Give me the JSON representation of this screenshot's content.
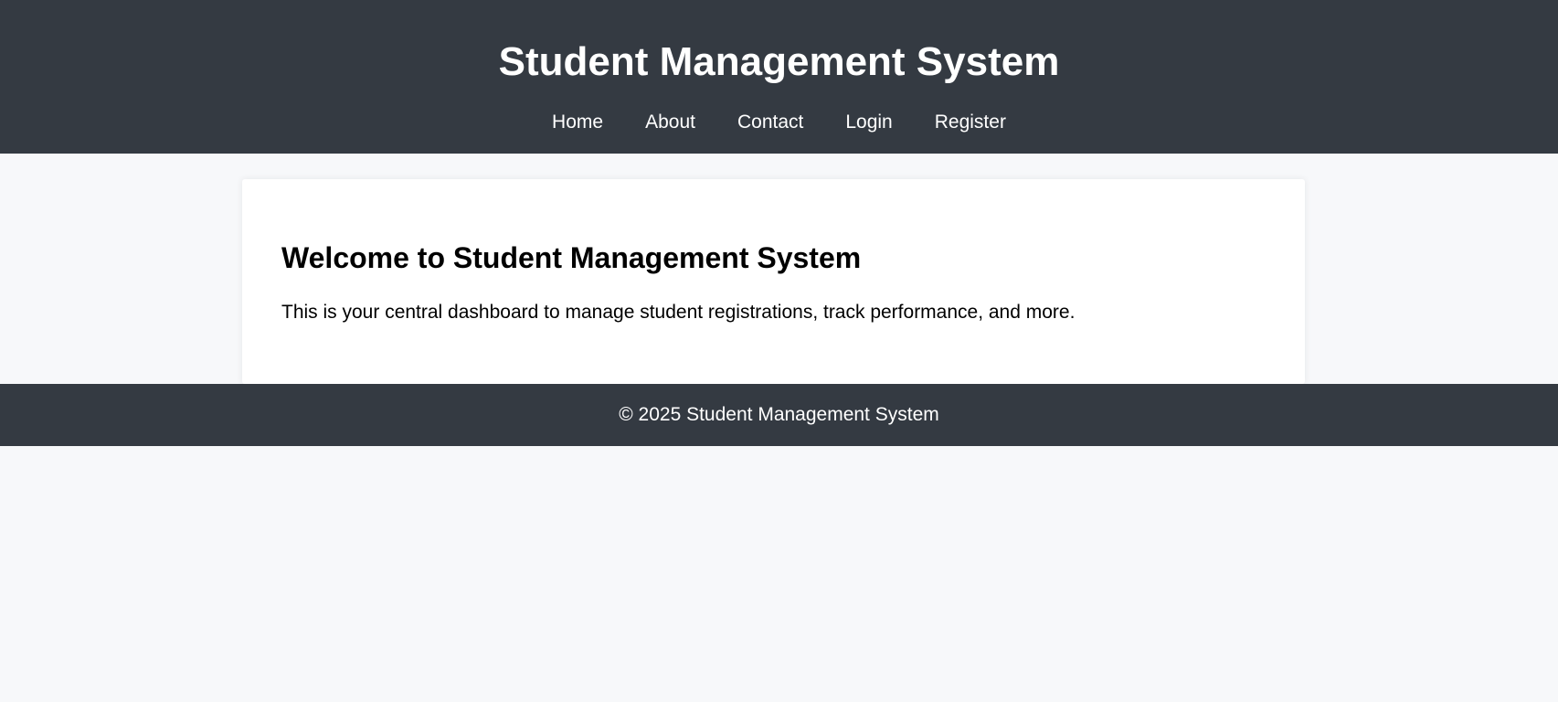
{
  "header": {
    "title": "Student Management System",
    "nav": [
      "Home",
      "About",
      "Contact",
      "Login",
      "Register"
    ]
  },
  "main": {
    "heading": "Welcome to Student Management System",
    "description": "This is your central dashboard to manage student registrations, track performance, and more."
  },
  "footer": {
    "text": "© 2025 Student Management System"
  },
  "colors": {
    "header_bg": "#343a42",
    "page_bg": "#f7f8fa",
    "card_bg": "#ffffff",
    "text_light": "#ffffff",
    "text_dark": "#000000"
  }
}
